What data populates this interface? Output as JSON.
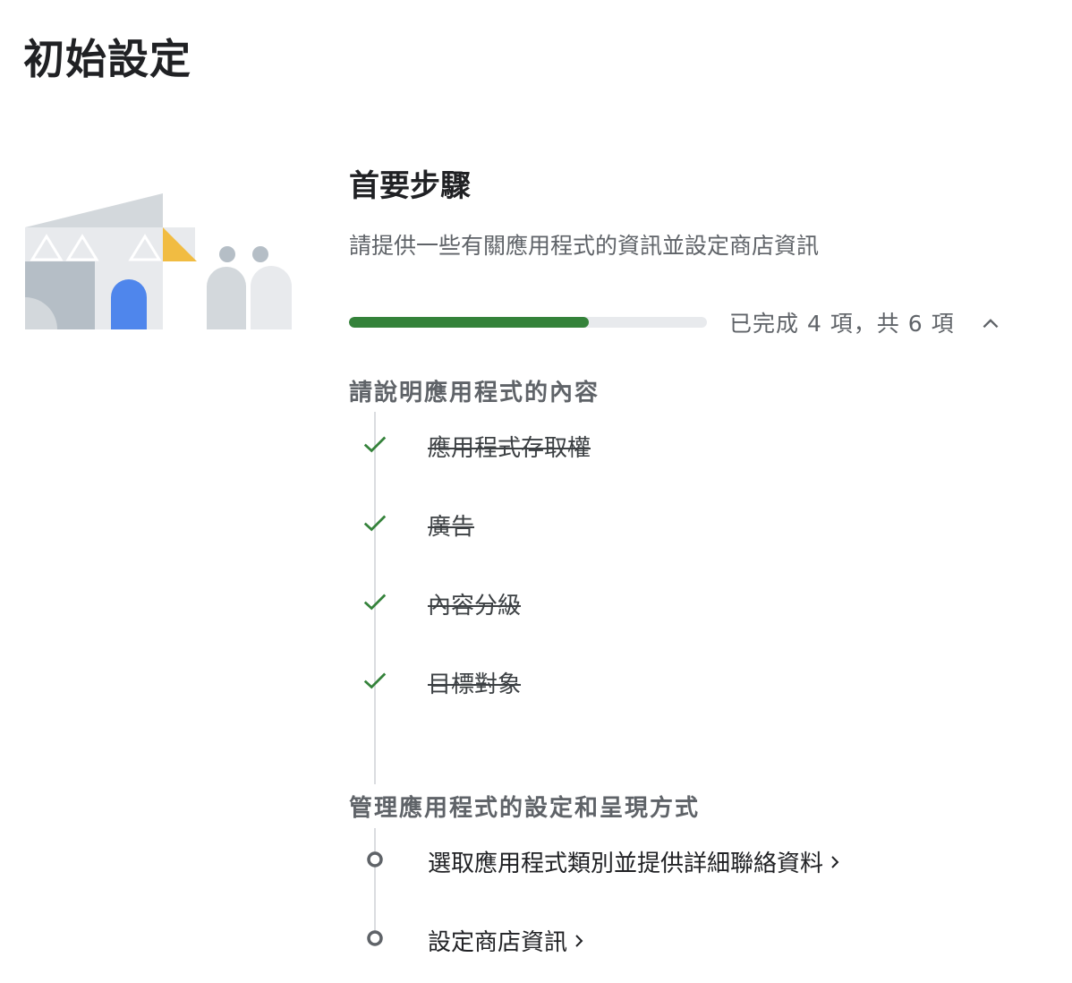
{
  "page": {
    "title": "初始設定"
  },
  "section": {
    "title": "首要步驟",
    "description": "請提供一些有關應用程式的資訊並設定商店資訊"
  },
  "progress": {
    "completed": 4,
    "total": 6,
    "fraction": 0.67,
    "label": "已完成 4 項，共 6 項",
    "fill_color": "#34823a"
  },
  "groups": [
    {
      "title": "請說明應用程式的內容",
      "steps": [
        {
          "label": "應用程式存取權",
          "status": "done",
          "icon": "check-icon"
        },
        {
          "label": "廣告",
          "status": "done",
          "icon": "check-icon"
        },
        {
          "label": "內容分級",
          "status": "done",
          "icon": "check-icon"
        },
        {
          "label": "目標對象",
          "status": "done",
          "icon": "check-icon"
        }
      ]
    },
    {
      "title": "管理應用程式的設定和呈現方式",
      "steps": [
        {
          "label": "選取應用程式類別並提供詳細聯絡資料",
          "status": "pending",
          "icon": "circle-icon"
        },
        {
          "label": "設定商店資訊",
          "status": "pending",
          "icon": "circle-icon"
        }
      ]
    }
  ],
  "colors": {
    "check": "#34823a",
    "pending_circle": "#5f6368",
    "accent_blue": "#4f86ec",
    "accent_yellow": "#f1bc42"
  }
}
